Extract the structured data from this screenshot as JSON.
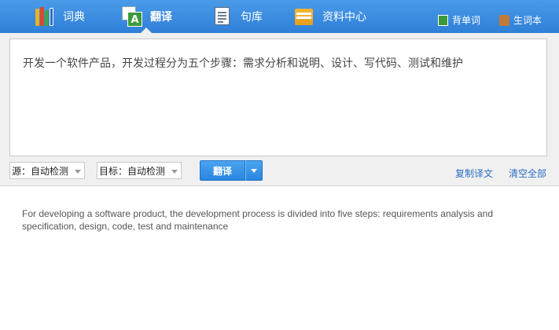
{
  "nav": {
    "tabs": [
      {
        "label": "词典",
        "icon": "books-icon"
      },
      {
        "label": "翻译",
        "icon": "translate-icon",
        "active": true
      },
      {
        "label": "句库",
        "icon": "document-icon"
      },
      {
        "label": "资料中心",
        "icon": "folder-icon"
      }
    ],
    "right_links": [
      {
        "label": "背单词",
        "icon": "vocab-icon"
      },
      {
        "label": "生词本",
        "icon": "wordbook-icon"
      }
    ]
  },
  "translate": {
    "source_text": "开发一个软件产品，开发过程分为五个步骤：需求分析和说明、设计、写代码、测试和维护",
    "source_lang": "源：自动检测",
    "target_lang": "目标：自动检测",
    "translate_button": "翻译",
    "copy_link": "复制译文",
    "clear_link": "清空全部",
    "result_text": "For developing a software product, the development process is divided into five steps: requirements analysis and specification, design, code, test and maintenance"
  },
  "colors": {
    "nav_bg": "#3a8ce0",
    "accent": "#2a86e0",
    "link": "#2a6fc4"
  }
}
